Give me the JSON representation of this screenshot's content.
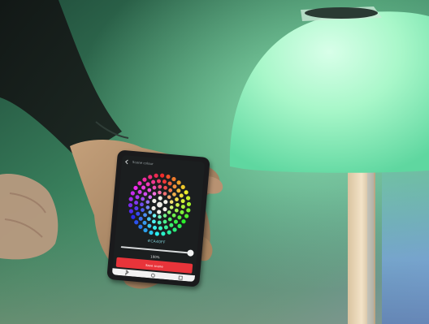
{
  "photo": {
    "subject": "hand holding smartphone controlling a smart light bulb",
    "colors": {
      "lamp_glow": "#8ff0c0",
      "background_green": "#3f8a66",
      "ambient_blue": "#6aa7e8"
    }
  },
  "phone_screen": {
    "app_title": "Scene colour",
    "selected_hex": "#CA40FF",
    "brightness_label": "100%",
    "brightness_value": 100,
    "save_button_label": "Save scene",
    "accent_color": "#e8343a"
  }
}
